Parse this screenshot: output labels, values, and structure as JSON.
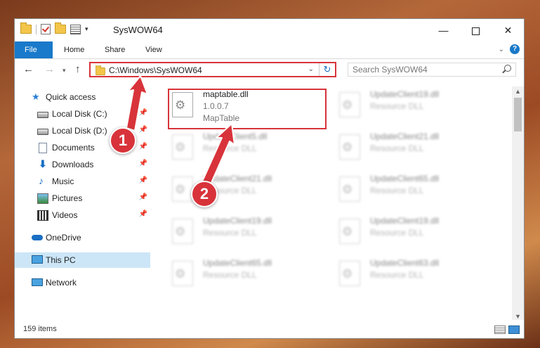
{
  "window": {
    "title": "SysWOW64"
  },
  "ribbon": {
    "tabs": [
      "File",
      "Home",
      "Share",
      "View"
    ],
    "help_label": "?"
  },
  "nav": {
    "address": "C:\\Windows\\SysWOW64",
    "search_placeholder": "Search SysWOW64"
  },
  "sidebar": {
    "items": [
      {
        "label": "Quick access",
        "icon": "star-icon"
      },
      {
        "label": "Local Disk (C:)",
        "icon": "disk-icon"
      },
      {
        "label": "Local Disk (D:)",
        "icon": "disk-icon"
      },
      {
        "label": "Documents",
        "icon": "documents-icon"
      },
      {
        "label": "Downloads",
        "icon": "downloads-icon"
      },
      {
        "label": "Music",
        "icon": "music-icon"
      },
      {
        "label": "Pictures",
        "icon": "pictures-icon"
      },
      {
        "label": "Videos",
        "icon": "videos-icon"
      },
      {
        "label": "OneDrive",
        "icon": "onedrive-icon"
      },
      {
        "label": "This PC",
        "icon": "this-pc-icon"
      },
      {
        "label": "Network",
        "icon": "network-icon"
      }
    ]
  },
  "files": {
    "highlighted": {
      "name": "maptable.dll",
      "version": "1.0.0.7",
      "description": "MapTable"
    },
    "blurred": [
      {
        "name": "UpdateClient19.dll",
        "description": "Resource DLL"
      },
      {
        "name": "UpdateClient5.dll",
        "description": "Resource DLL"
      },
      {
        "name": "UpdateClient21.dll",
        "description": "Resource DLL"
      },
      {
        "name": "UpdateClient21.dll",
        "description": "Resource DLL"
      },
      {
        "name": "UpdateClient65.dll",
        "description": "Resource DLL"
      },
      {
        "name": "UpdateClient19.dll",
        "description": "Resource DLL"
      },
      {
        "name": "UpdateClient19.dll",
        "description": "Resource DLL"
      },
      {
        "name": "UpdateClient65.dll",
        "description": "Resource DLL"
      },
      {
        "name": "UpdateClient63.dll",
        "description": "Resource DLL"
      }
    ]
  },
  "status": {
    "item_count": "159 items"
  },
  "annotations": {
    "step1": "1",
    "step2": "2"
  },
  "colors": {
    "accent": "#1979ca",
    "highlight": "#d8333a",
    "selected_bg": "#cce6f7"
  }
}
